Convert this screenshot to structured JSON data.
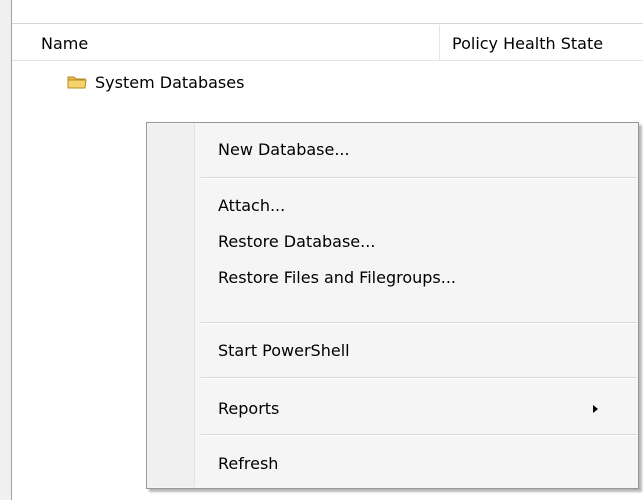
{
  "list_header": {
    "name_column": "Name",
    "policy_column": "Policy Health State"
  },
  "tree": {
    "items": [
      {
        "label": "System Databases",
        "icon": "folder-icon"
      }
    ]
  },
  "context_menu": {
    "items": [
      {
        "label": "New Database..."
      },
      {
        "label": "Attach..."
      },
      {
        "label": "Restore Database..."
      },
      {
        "label": "Restore Files and Filegroups..."
      },
      {
        "label": "Start PowerShell"
      },
      {
        "label": "Reports",
        "has_submenu": true,
        "icon": "chevron-right-icon"
      },
      {
        "label": "Refresh"
      }
    ]
  },
  "colors": {
    "menu_background": "#f5f5f5",
    "menu_border": "#979797",
    "folder_yellow": "#f4d36b"
  }
}
